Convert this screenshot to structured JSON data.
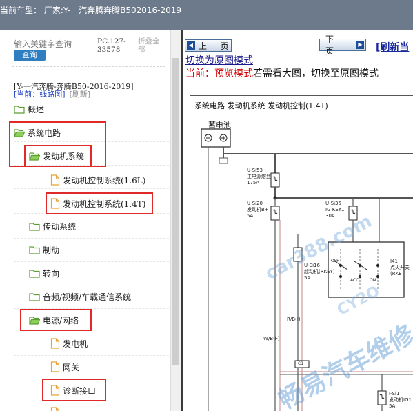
{
  "header": {
    "title": "当前车型：  厂家:Y-一汽奔腾奔腾B502016-2019"
  },
  "search": {
    "placeholder": "输入关键字查询",
    "button_label": "查询"
  },
  "pc_code": "PC.127-33578",
  "collapse_all_label": "折叠全部",
  "model_line": "[Y-一汽奔腾-奔腾B50-2016-2019]",
  "current_label": "[当前：线路图]",
  "refresh_small": "[刷新]",
  "tree": [
    {
      "label": "概述",
      "icon": "folder-icon"
    },
    {
      "label": "系统电路",
      "icon": "folder-open-icon"
    },
    {
      "label": "发动机系统",
      "icon": "folder-open-icon"
    },
    {
      "label": "发动机控制系统(1.6L)",
      "icon": "file-icon"
    },
    {
      "label": "发动机控制系统(1.4T)",
      "icon": "file-icon"
    },
    {
      "label": "传动系统",
      "icon": "folder-icon"
    },
    {
      "label": "制动",
      "icon": "folder-icon"
    },
    {
      "label": "转向",
      "icon": "folder-icon"
    },
    {
      "label": "音频/视频/车载通信系统",
      "icon": "folder-icon"
    },
    {
      "label": "电源/网络",
      "icon": "folder-open-icon"
    },
    {
      "label": "发电机",
      "icon": "file-icon"
    },
    {
      "label": "网关",
      "icon": "file-icon"
    },
    {
      "label": "诊断接口",
      "icon": "file-icon"
    }
  ],
  "nav": {
    "prev_label": "上 一 页",
    "next_label": "下 一 页",
    "refresh_label": "[刷新当"
  },
  "switch_link": "切换为原图模式",
  "mode": {
    "prefix": "当前：",
    "mode_name": "预览模式",
    "suffix": "若需看大图，切换至原图模式"
  },
  "diagram": {
    "title": "系统电路  发动机系统  发动机控制(1.4T)",
    "battery_label": "蓄电池",
    "fuses": [
      {
        "id": "U-Si53",
        "desc": "主电源熔丝",
        "amp": "175A"
      },
      {
        "id": "U-Si20",
        "desc": "发动机B+",
        "amp": "5A"
      },
      {
        "id": "U-Si35",
        "desc": "IG KEY1",
        "amp": "30A"
      },
      {
        "id": "U-Si16",
        "desc": "起动机(RKEY)",
        "amp": "5A"
      },
      {
        "id": "I-Si1",
        "desc": "发动机IG1",
        "amp": "5A"
      }
    ],
    "wire_labels": [
      "R/B(I)",
      "W/B(F)"
    ],
    "connector_labels": [
      "C1"
    ],
    "switch_label_lines": [
      "I41",
      "点火开关",
      "(RKE"
    ],
    "switch_positions": [
      "OFF",
      "ACC",
      "ON"
    ]
  },
  "watermarks": [
    "car388.com",
    "畅易汽车维修",
    "CY2O"
  ],
  "colors": {
    "highlight": "#e02a2a",
    "folder": "#6cb33e",
    "file": "#e8a23a",
    "link": "#1a1a8a",
    "red_text": "#d40000",
    "topbar": "#6d7a8b"
  }
}
